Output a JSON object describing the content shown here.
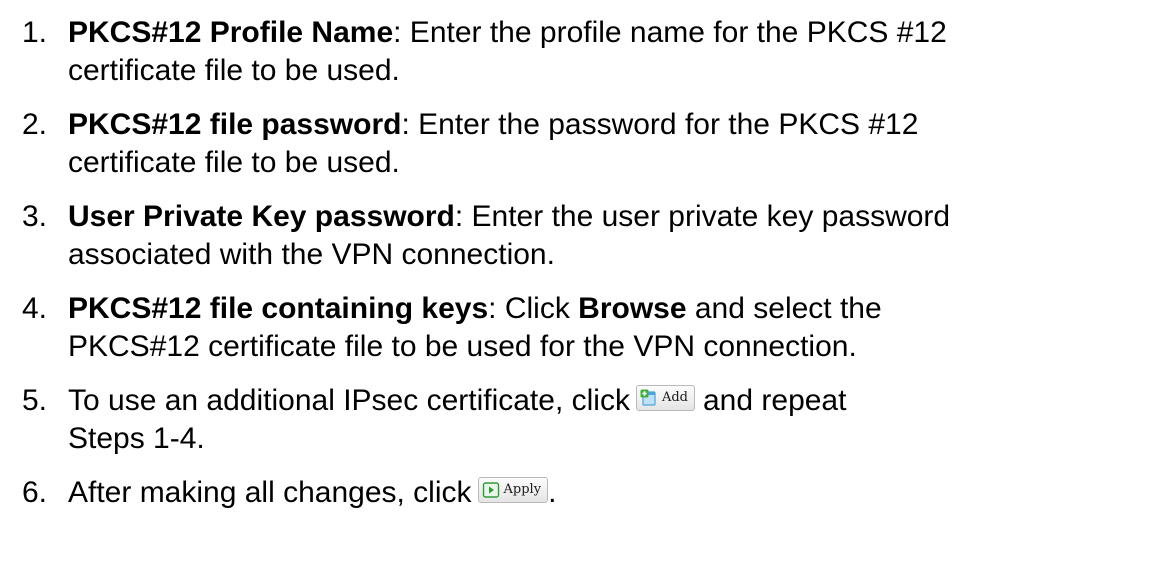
{
  "steps": [
    {
      "number": "1.",
      "title": "PKCS#12 Profile Name",
      "text_1": ": Enter the profile name for the PKCS #12",
      "text_2": "certificate file to be used."
    },
    {
      "number": "2.",
      "title": "PKCS#12 file password",
      "text_1": ": Enter the password for the PKCS #12",
      "text_2": "certificate file to be used."
    },
    {
      "number": "3.",
      "title": "User Private Key password",
      "text_1": ": Enter the user private key password",
      "text_2": "associated with the VPN connection."
    },
    {
      "number": "4.",
      "title": "PKCS#12 file containing keys",
      "text_1": ": Click ",
      "browse": "Browse",
      "text_1b": " and select the",
      "text_2": "PKCS#12 certificate file to be used for the VPN connection."
    },
    {
      "number": "5.",
      "text_1": "To use an additional IPsec certificate, click",
      "text_1b": "and repeat",
      "text_2": "Steps 1-4."
    },
    {
      "number": "6.",
      "text_1": "After making all changes, click",
      "text_1b": "."
    }
  ],
  "buttons": {
    "add": {
      "label": "Add",
      "icon": "add-document-icon"
    },
    "apply": {
      "label": "Apply",
      "icon": "apply-icon"
    }
  },
  "colors": {
    "text": "#000000",
    "add_icon": "#4da3d8",
    "add_plus": "#3fae3f",
    "apply_icon": "#2f9a3a"
  }
}
